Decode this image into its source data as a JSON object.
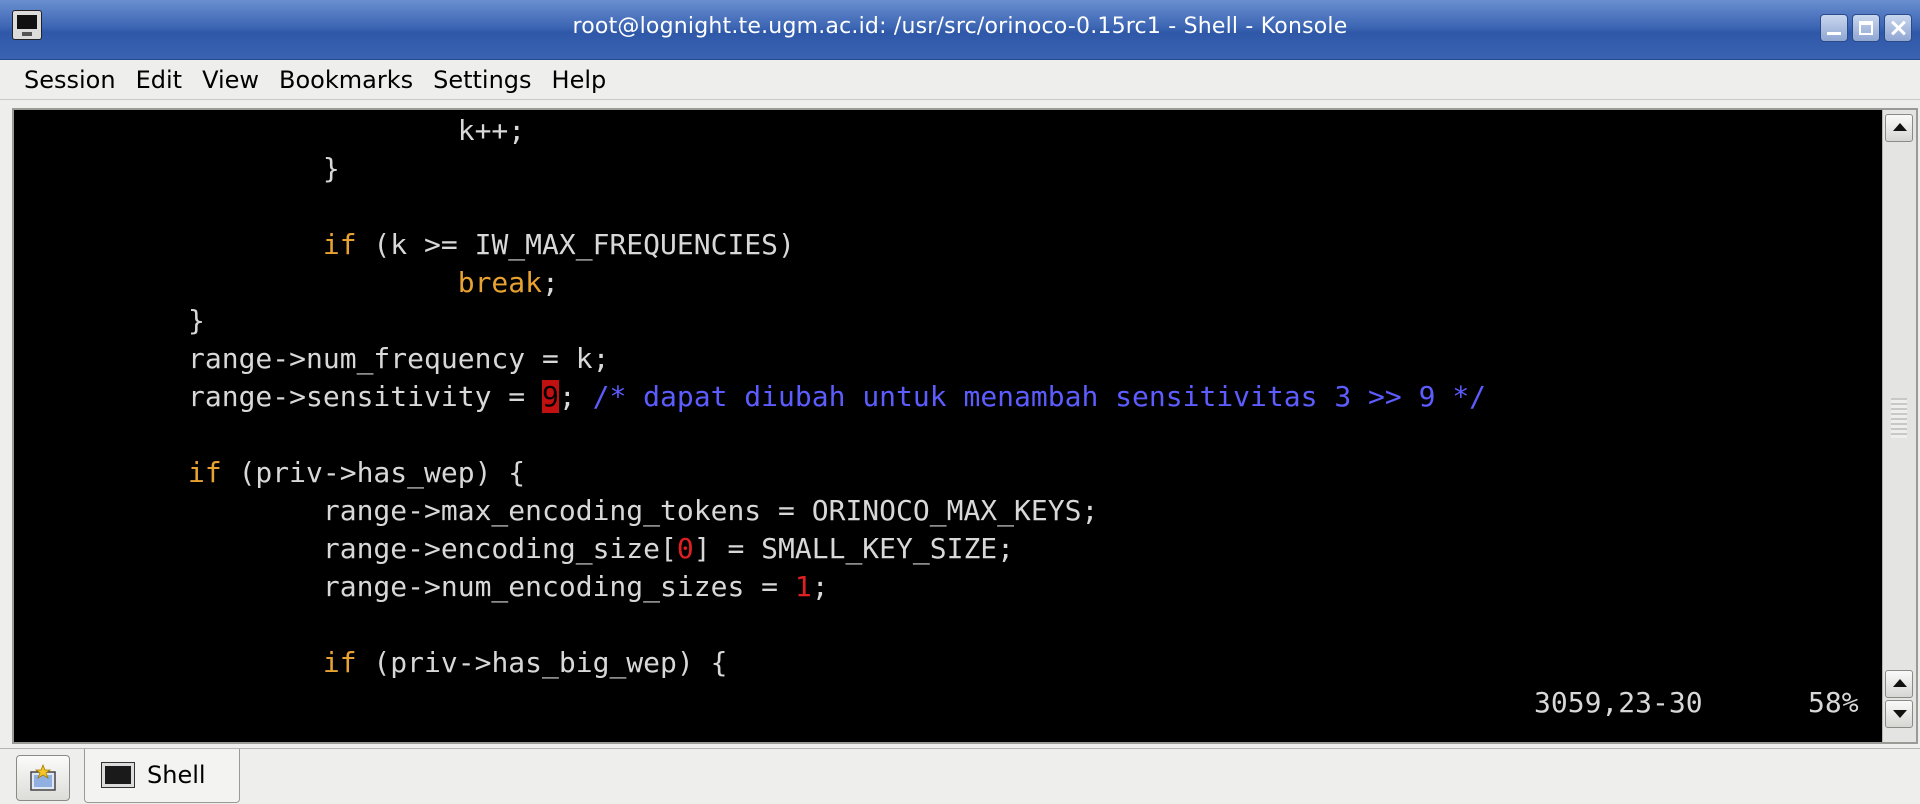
{
  "window": {
    "title": "root@lognight.te.ugm.ac.id: /usr/src/orinoco-0.15rc1 - Shell - Konsole",
    "app_icon": "konsole-icon",
    "controls": [
      "minimize-icon",
      "maximize-icon",
      "close-icon"
    ]
  },
  "menu": {
    "items": [
      "Session",
      "Edit",
      "View",
      "Bookmarks",
      "Settings",
      "Help"
    ]
  },
  "terminal": {
    "colors": {
      "background": "#000000",
      "text": "#d8d8d8",
      "keyword": "#e8a231",
      "comment": "#5c5cff",
      "number": "#e02020",
      "cursor": "#c01010"
    },
    "lines": [
      {
        "indent": "                ",
        "code": "k++;"
      },
      {
        "indent": "        ",
        "code": "}"
      },
      {
        "indent": "",
        "code": ""
      },
      {
        "indent": "        ",
        "kw": "if",
        "code": " (k >= IW_MAX_FREQUENCIES)"
      },
      {
        "indent": "                ",
        "kw": "break",
        "code": ";"
      },
      {
        "indent": "",
        "code": "}"
      },
      {
        "indent": "",
        "code": "range->num_frequency = k;"
      },
      {
        "indent": "",
        "pre": "range->sensitivity = ",
        "cursor_char": "9",
        "post": "; ",
        "comment": "/* dapat diubah untuk menambah sensitivitas 3 >> 9 */"
      },
      {
        "indent": "",
        "code": ""
      },
      {
        "indent": "",
        "kw": "if",
        "code": " (priv->has_wep) {"
      },
      {
        "indent": "        ",
        "code": "range->max_encoding_tokens = ORINOCO_MAX_KEYS;"
      },
      {
        "indent": "        ",
        "pre": "range->encoding_size[",
        "num": "0",
        "post": "] = SMALL_KEY_SIZE;"
      },
      {
        "indent": "        ",
        "pre": "range->num_encoding_sizes = ",
        "num": "1",
        "post": ";"
      },
      {
        "indent": "",
        "code": ""
      },
      {
        "indent": "        ",
        "kw": "if",
        "code": " (priv->has_big_wep) {"
      }
    ],
    "status": {
      "position": "3059,23-30",
      "percent": "58%"
    }
  },
  "scrollbar": {
    "up": "scroll-up-icon",
    "down": "scroll-down-icon"
  },
  "tabs": {
    "new_tab_icon": "new-session-icon",
    "items": [
      {
        "label": "Shell",
        "icon": "terminal-icon"
      }
    ]
  }
}
